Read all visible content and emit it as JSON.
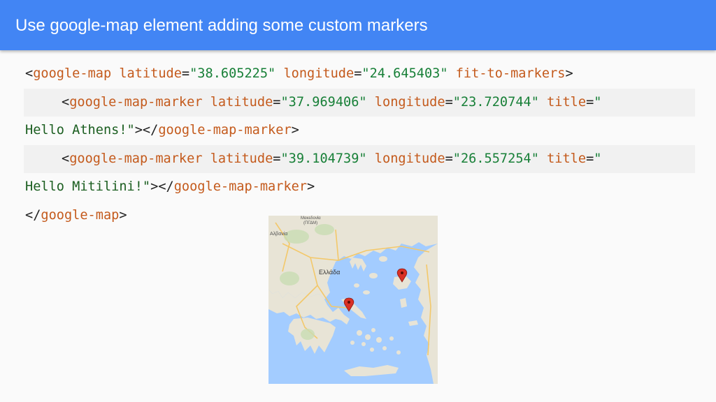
{
  "header": {
    "title": "Use google-map element adding some custom markers"
  },
  "code": {
    "line1": {
      "lt": "<",
      "tag": "google-map",
      "attr1": " latitude",
      "eq1": "=",
      "val1": "\"38.605225\"",
      "attr2": " longitude",
      "eq2": "=",
      "val2": "\"24.645403\"",
      "attr3": " fit-to-markers",
      "gt": ">"
    },
    "line2": {
      "lt": "<",
      "tag": "google-map-marker",
      "attr1": " latitude",
      "eq1": "=",
      "val1": "\"37.969406\"",
      "attr2": " longitude",
      "eq2": "=",
      "val2": "\"23.720744\"",
      "attr3": " title",
      "eq3": "=",
      "val3": "\""
    },
    "line3": {
      "text": "Hello Athens!\"",
      "gt": "></",
      "tag": "google-map-marker",
      "end": ">"
    },
    "line4": {
      "lt": "<",
      "tag": "google-map-marker",
      "attr1": " latitude",
      "eq1": "=",
      "val1": "\"39.104739\"",
      "attr2": " longitude",
      "eq2": "=",
      "val2": "\"26.557254\"",
      "attr3": " title",
      "eq3": "=",
      "val3": "\""
    },
    "line5": {
      "text": "Hello Mitilini!\"",
      "gt": "></",
      "tag": "google-map-marker",
      "end": ">"
    },
    "line6": {
      "lt": "</",
      "tag": "google-map",
      "end": ">"
    }
  },
  "map": {
    "label_country": "Ελλάδα",
    "label_albania": "Αλβανία",
    "label_macedonia": "Μακεδονία",
    "label_macedonia_sub": "(ΠΓΔΜ)",
    "colors": {
      "sea": "#a3ccff",
      "land": "#e8e4d6",
      "road": "#f3c86a",
      "marker": "#d93025"
    }
  }
}
